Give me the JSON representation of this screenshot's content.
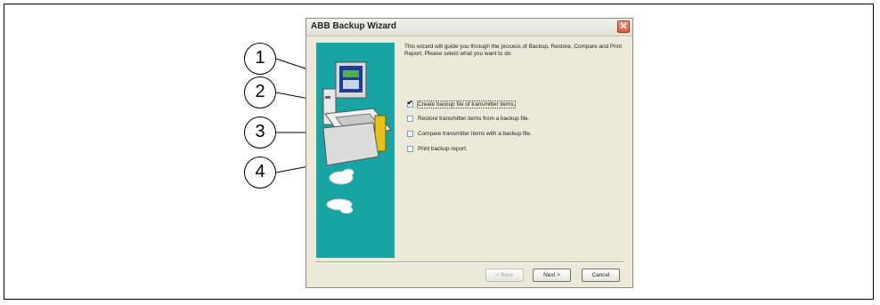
{
  "dialog": {
    "title": "ABB Backup Wizard",
    "close_glyph": "✕",
    "intro": "This wizard will guide you through the process of Backup, Restore, Compare and Print Report. Please select what you want to do:",
    "options": [
      {
        "label": "Create backup file of transmitter items.",
        "checked": true
      },
      {
        "label": "Restore transmitter items from a backup file.",
        "checked": false
      },
      {
        "label": "Compare transmitter items with a backup file.",
        "checked": false
      },
      {
        "label": "Print backup report.",
        "checked": false
      }
    ],
    "buttons": {
      "back": "< Back",
      "next": "Next >",
      "cancel": "Cancel"
    }
  },
  "callouts": [
    "1",
    "2",
    "3",
    "4"
  ],
  "icons": {
    "side_art": "computer-with-hands-illustration",
    "close": "close-icon"
  }
}
